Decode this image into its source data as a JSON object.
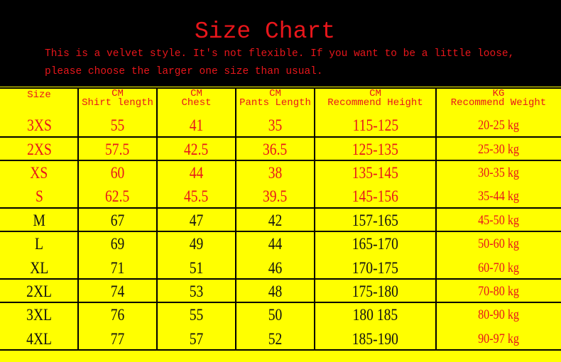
{
  "title": "Size Chart",
  "notes": [
    "This is a velvet style. It's not flexible. If you want to be a little loose,",
    "please choose the larger one size than usual."
  ],
  "colors": {
    "header_bg": "#000000",
    "table_bg": "#ffff00",
    "accent_red": "#e8161b"
  },
  "columns": [
    {
      "unit": "",
      "label": "Size"
    },
    {
      "unit": "CM",
      "label": "Shirt length"
    },
    {
      "unit": "CM",
      "label": "Chest"
    },
    {
      "unit": "CM",
      "label": "Pants Length"
    },
    {
      "unit": "CM",
      "label": "Recommend Height"
    },
    {
      "unit": "KG",
      "label": "Recommend Weight"
    }
  ],
  "rows": [
    [
      "3XS",
      "55",
      "41",
      "35",
      "115-125",
      "20-25 kg"
    ],
    [
      "2XS",
      "57.5",
      "42.5",
      "36.5",
      "125-135",
      "25-30 kg"
    ],
    [
      "XS",
      "60",
      "44",
      "38",
      "135-145",
      "30-35 kg"
    ],
    [
      "S",
      "62.5",
      "45.5",
      "39.5",
      "145-156",
      "35-44 kg"
    ],
    [
      "M",
      "67",
      "47",
      "42",
      "157-165",
      "45-50 kg"
    ],
    [
      "L",
      "69",
      "49",
      "44",
      "165-170",
      "50-60 kg"
    ],
    [
      "XL",
      "71",
      "51",
      "46",
      "170-175",
      "60-70 kg"
    ],
    [
      "2XL",
      "74",
      "53",
      "48",
      "175-180",
      "70-80 kg"
    ],
    [
      "3XL",
      "76",
      "55",
      "50",
      "180 185",
      "80-90 kg"
    ],
    [
      "4XL",
      "77",
      "57",
      "52",
      "185-190",
      "90-97 kg"
    ]
  ]
}
